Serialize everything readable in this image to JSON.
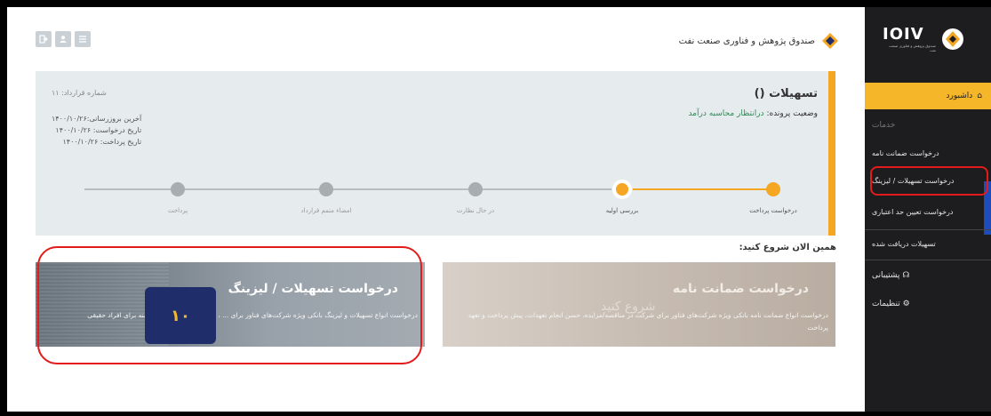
{
  "header": {
    "brand_text": "صندوق پژوهش و فناوری صنعت نفت",
    "toolbar_icons": [
      "logout-icon",
      "user-icon",
      "menu-icon"
    ]
  },
  "status_card": {
    "title": "تسهیلات ()",
    "status_label": "وضعیت پرونده:",
    "status_value": "درانتظار محاسبه درآمد",
    "contract_no": "شماره قرارداد: ۱۱",
    "last_update": "آخرین بروزرسانی:۱۴۰۰/۱۰/۲۶",
    "request_date": "تاریخ درخواست: ۱۴۰۰/۱۰/۲۶",
    "payment_date": "تاریخ پرداخت: ۱۴۰۰/۱۰/۲۶",
    "steps": [
      {
        "label": "درخواست پرداخت",
        "state": "done"
      },
      {
        "label": "بررسی اولیه",
        "state": "active"
      },
      {
        "label": "در حال نظارت",
        "state": "pending"
      },
      {
        "label": "امضاء متمم قرارداد",
        "state": "pending"
      },
      {
        "label": "پرداخت",
        "state": "pending"
      }
    ],
    "accent_color": "#f5a623"
  },
  "start_section": {
    "title": "همین الان شروع کنید:"
  },
  "tiles": {
    "facilities": {
      "title": "درخواست تسهیلات / لیزینگ",
      "description": "درخواست انواع تسهیلات و لیزینگ بانکی ویژه شرکت‌های فناور برای ... ، تولید صنعتی و قرض الحسنه برای افراد حقیقی"
    },
    "guarantee": {
      "title": "درخواست ضمانت نامه",
      "ghost": "شروع کنید",
      "description": "درخواست انواع ضمانت نامه بانکی ویژه شرکت‌های فناور برای شرکت در مناقصه/مزایده، حسن انجام تعهدات، پیش پرداخت و تعهد پرداخت"
    }
  },
  "badge": {
    "number": "۱۰"
  },
  "sidebar": {
    "logo_word": "IOIV",
    "logo_sub": "صندوق پژوهش و فناوری صنعت نفت",
    "dashboard": "داشبورد",
    "services_heading": "خدمات",
    "items": [
      {
        "label": "درخواست ضمانت نامه"
      },
      {
        "label": "درخواست تسهیلات / لیزینگ"
      },
      {
        "label": "درخواست تعیین حد اعتباری"
      },
      {
        "label": "تسهیلات دریافت شده"
      }
    ],
    "support": "پشتیبانی",
    "settings": "تنظیمات"
  }
}
